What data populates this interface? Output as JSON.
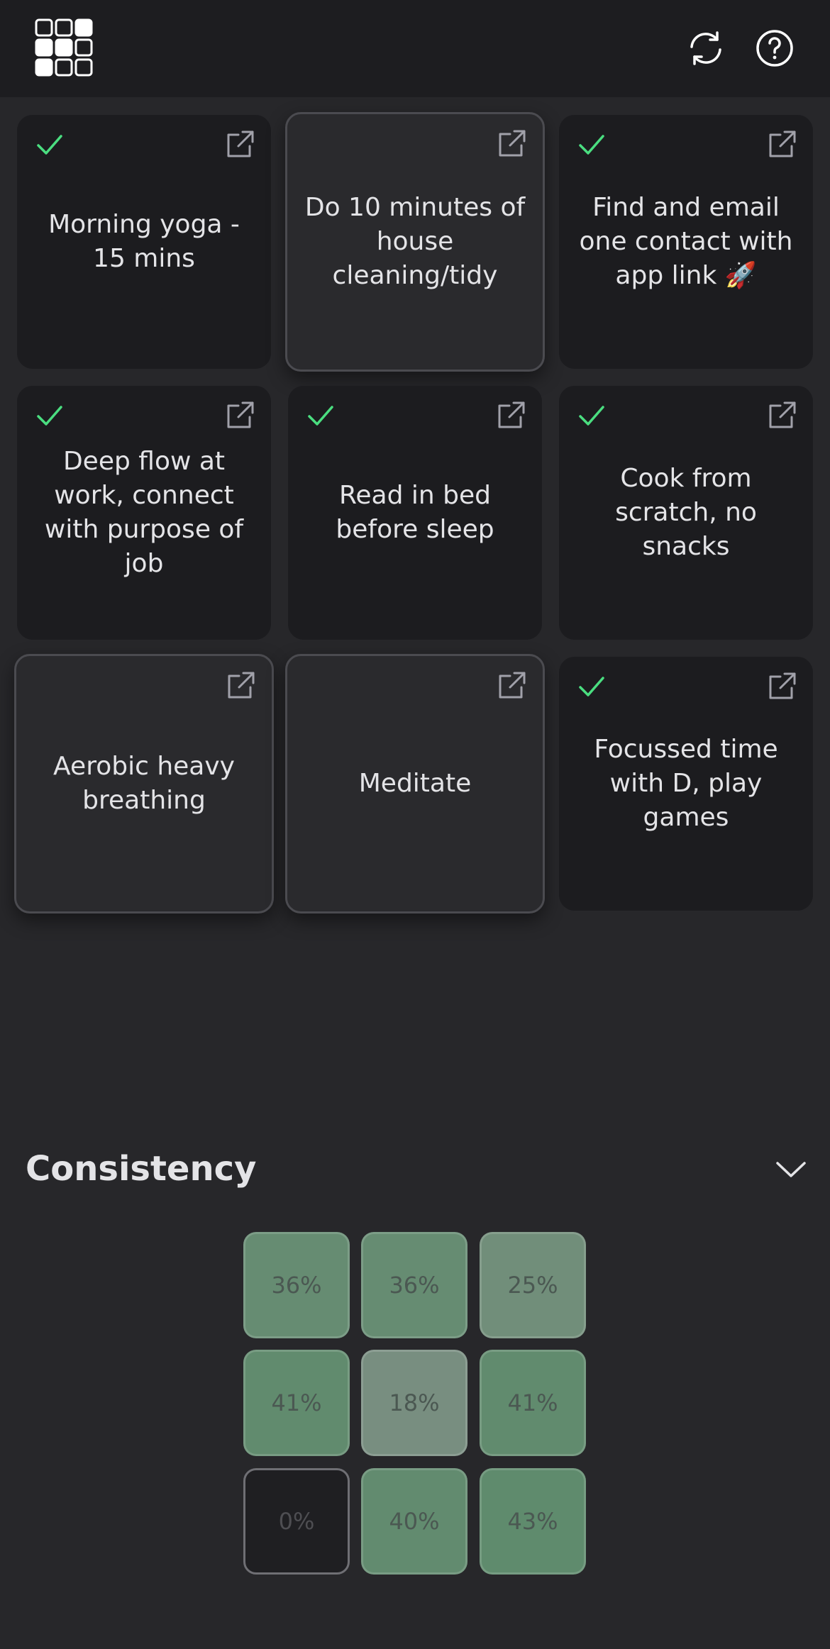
{
  "header": {
    "logo_icon": "grid-logo-icon",
    "refresh_icon": "refresh-icon",
    "help_icon": "help-circle-icon"
  },
  "habits": [
    {
      "label": "Morning yoga - 15 mins",
      "done": true
    },
    {
      "label": "Do 10 minutes of house cleaning/tidy",
      "done": false
    },
    {
      "label": "Find and email one contact with app link 🚀",
      "done": true
    },
    {
      "label": "Deep flow at work, connect with purpose of job",
      "done": true
    },
    {
      "label": "Read in bed before sleep",
      "done": true
    },
    {
      "label": "Cook from scratch, no snacks",
      "done": true
    },
    {
      "label": "Aerobic heavy breathing",
      "done": false
    },
    {
      "label": "Meditate",
      "done": false
    },
    {
      "label": "Focussed time with D, play games",
      "done": true
    }
  ],
  "consistency": {
    "title": "Consistency",
    "collapse_icon": "chevron-down-icon",
    "cells": [
      "36%",
      "36%",
      "25%",
      "41%",
      "18%",
      "41%",
      "0%",
      "40%",
      "43%"
    ],
    "values": [
      0.36,
      0.36,
      0.25,
      0.41,
      0.18,
      0.41,
      0.0,
      0.4,
      0.43
    ]
  },
  "colors": {
    "check": "#4ade80",
    "background": "#27272a",
    "card": "#1c1c1f"
  }
}
